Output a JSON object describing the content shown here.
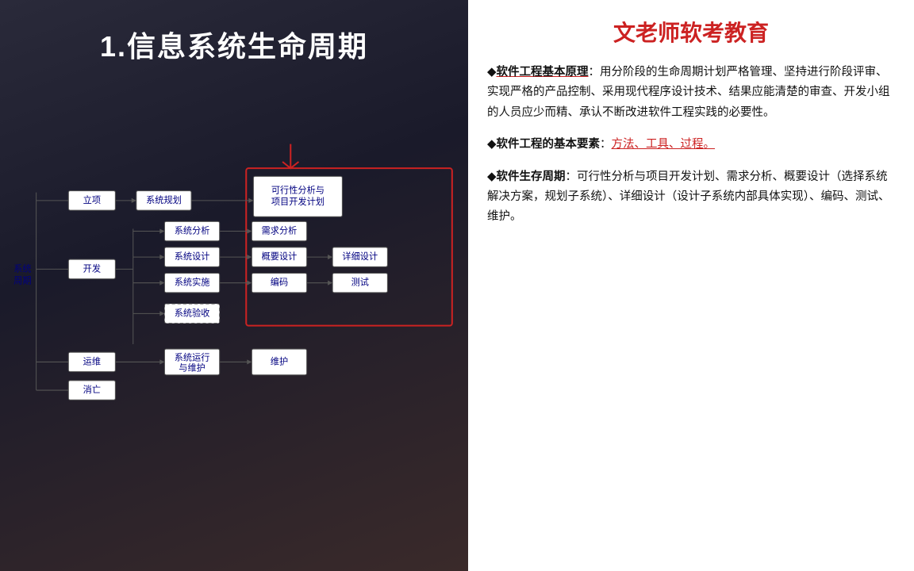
{
  "left": {
    "title": "1.信息系统生命周期",
    "diagram": {
      "left_label_line1": "系统",
      "left_label_line2": "周期",
      "nodes": {
        "liXiang": "立项↵",
        "kaiFa": "开发↵",
        "yunWei": "运维↵",
        "xiaoWang": "消亡↵",
        "xitongGuiHua": "系统规划↵",
        "xitongFenXi": "系统分析↵",
        "xitongSheJi": "系统设计↵",
        "xitongShiShi": "系统实施↵",
        "xitongYanShou": "系统验收↵",
        "xitongYunXing1": "系统运行",
        "xitongYunXing2": "与维护↵",
        "keXingXing": "可行性分析与项目开发计划↵",
        "xuQiuFenXi": "需求分析↵",
        "gaiYaoSheJi": "概要设计↵",
        "bianMa": "编码↵",
        "xiangXiSheJi": "详细设计↵",
        "ceShi": "测试↵",
        "weiHu": "维护↵"
      }
    }
  },
  "right": {
    "title": "文老师软考教育",
    "sections": [
      {
        "id": "software-engineering-principles",
        "bullet": "◆",
        "title": "软件工程基本原理",
        "colon": "：",
        "body": "用分阶段的生命周期计划严格管理、坚持进行阶段评审、实现严格的产品控制、采用现代程序设计技术、结果应能清楚的审查、开发小组的人员应少而精、承认不断改进软件工程实践的必要性。"
      },
      {
        "id": "software-engineering-elements",
        "bullet": "◆",
        "title": "软件工程的基本要素",
        "colon": "：",
        "elements": [
          "方法",
          "工具",
          "过程"
        ],
        "separator": "、",
        "end": "。"
      },
      {
        "id": "software-lifecycle",
        "bullet": "◆",
        "title": "软件生存周期",
        "colon": "：",
        "body": "可行性分析与项目开发计划、需求分析、概要设计（选择系统解决方案，规划子系统）、详细设计（设计子系统内部具体实现）、编码、测试、维护。"
      }
    ]
  }
}
